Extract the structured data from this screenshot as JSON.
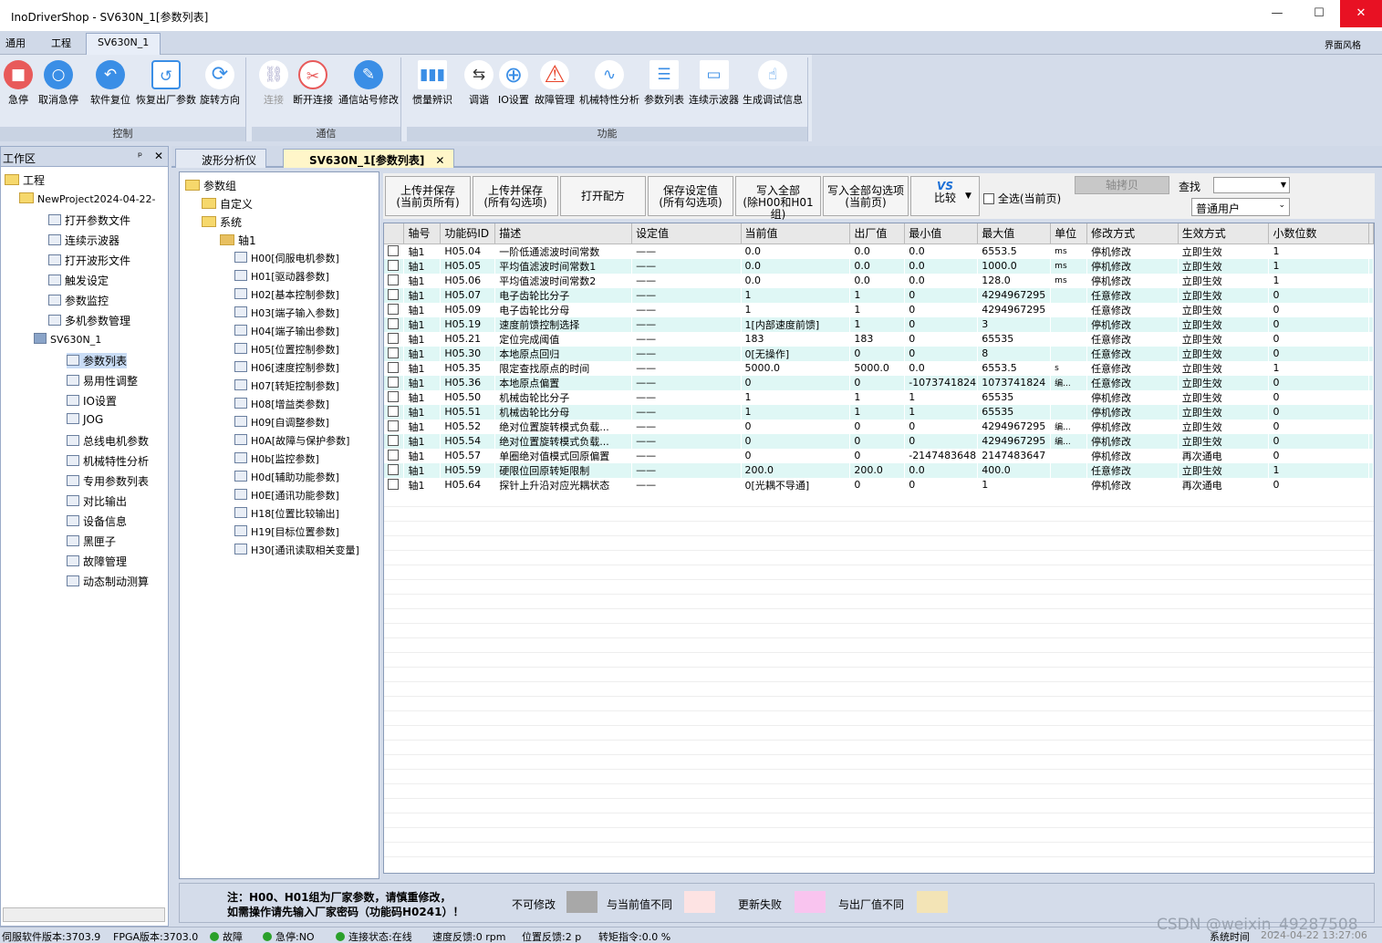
{
  "window": {
    "title": "InoDriverShop - SV630N_1[参数列表]",
    "min": "—",
    "max": "☐",
    "close": "✕"
  },
  "menu": {
    "tabs": [
      "通用",
      "工程",
      "SV630N_1"
    ],
    "style": "界面风格"
  },
  "ribbon": {
    "control": {
      "caption": "控制",
      "buttons": [
        "急停",
        "取消急停",
        "软件复位",
        "恢复出厂参数",
        "旋转方向"
      ]
    },
    "comm": {
      "caption": "通信",
      "buttons": [
        "连接",
        "断开连接",
        "通信站号修改"
      ]
    },
    "func": {
      "caption": "功能",
      "buttons": [
        "惯量辨识",
        "调谐",
        "IO设置",
        "故障管理",
        "机械特性分析",
        "参数列表",
        "连续示波器",
        "生成调试信息"
      ]
    }
  },
  "workspace": {
    "title": "工作区",
    "pin": "ᵖ",
    "close": "✕",
    "root": "工程",
    "project": "NewProject2024-04-22-",
    "items": [
      "打开参数文件",
      "连续示波器",
      "打开波形文件",
      "触发设定",
      "参数监控",
      "多机参数管理"
    ],
    "device": "SV630N_1",
    "device_items": [
      "参数列表",
      "易用性调整",
      "IO设置",
      "JOG",
      "总线电机参数",
      "机械特性分析",
      "专用参数列表",
      "对比输出",
      "设备信息",
      "黑匣子",
      "故障管理",
      "动态制动测算"
    ]
  },
  "tabs": {
    "tab1": "波形分析仪",
    "tab2": "SV630N_1[参数列表]",
    "close": "✕"
  },
  "groups": {
    "root": "参数组",
    "custom": "自定义",
    "system": "系统",
    "axis": "轴1",
    "items": [
      "H00[伺服电机参数]",
      "H01[驱动器参数]",
      "H02[基本控制参数]",
      "H03[端子输入参数]",
      "H04[端子输出参数]",
      "H05[位置控制参数]",
      "H06[速度控制参数]",
      "H07[转矩控制参数]",
      "H08[增益类参数]",
      "H09[自调整参数]",
      "H0A[故障与保护参数]",
      "H0b[监控参数]",
      "H0d[辅助功能参数]",
      "H0E[通讯功能参数]",
      "H18[位置比较输出]",
      "H19[目标位置参数]",
      "H30[通讯读取相关变量]"
    ]
  },
  "toolbar": {
    "b1a": "上传并保存",
    "b1b": "(当前页所有)",
    "b2a": "上传并保存",
    "b2b": "(所有勾选项)",
    "b3": "打开配方",
    "b4a": "保存设定值",
    "b4b": "(所有勾选项)",
    "b5a": "写入全部",
    "b5b": "(除H00和H01组)",
    "b6a": "写入全部勾选项",
    "b6b": "(当前页)",
    "b7a": "VS",
    "b7b": "比较",
    "selectall": "全选(当前页)",
    "axiscopy": "轴拷贝",
    "search": "查找",
    "user": "普通用户"
  },
  "table": {
    "headers": [
      "",
      "轴号",
      "功能码ID",
      "描述",
      "设定值",
      "当前值",
      "出厂值",
      "最小值",
      "最大值",
      "单位",
      "修改方式",
      "生效方式",
      "小数位数"
    ],
    "rows": [
      [
        "轴1",
        "H05.04",
        "一阶低通滤波时间常数",
        "——",
        "0.0",
        "0.0",
        "0.0",
        "6553.5",
        "ms",
        "停机修改",
        "立即生效",
        "1"
      ],
      [
        "轴1",
        "H05.05",
        "平均值滤波时间常数1",
        "——",
        "0.0",
        "0.0",
        "0.0",
        "1000.0",
        "ms",
        "停机修改",
        "立即生效",
        "1"
      ],
      [
        "轴1",
        "H05.06",
        "平均值滤波时间常数2",
        "——",
        "0.0",
        "0.0",
        "0.0",
        "128.0",
        "ms",
        "停机修改",
        "立即生效",
        "1"
      ],
      [
        "轴1",
        "H05.07",
        "电子齿轮比分子",
        "——",
        "1",
        "1",
        "0",
        "4294967295",
        "",
        "任意修改",
        "立即生效",
        "0"
      ],
      [
        "轴1",
        "H05.09",
        "电子齿轮比分母",
        "——",
        "1",
        "1",
        "0",
        "4294967295",
        "",
        "任意修改",
        "立即生效",
        "0"
      ],
      [
        "轴1",
        "H05.19",
        "速度前馈控制选择",
        "——",
        "1[内部速度前馈]",
        "1",
        "0",
        "3",
        "",
        "停机修改",
        "立即生效",
        "0"
      ],
      [
        "轴1",
        "H05.21",
        "定位完成阈值",
        "——",
        "183",
        "183",
        "0",
        "65535",
        "",
        "任意修改",
        "立即生效",
        "0"
      ],
      [
        "轴1",
        "H05.30",
        "本地原点回归",
        "——",
        "0[无操作]",
        "0",
        "0",
        "8",
        "",
        "任意修改",
        "立即生效",
        "0"
      ],
      [
        "轴1",
        "H05.35",
        "限定查找原点的时间",
        "——",
        "5000.0",
        "5000.0",
        "0.0",
        "6553.5",
        "s",
        "任意修改",
        "立即生效",
        "1"
      ],
      [
        "轴1",
        "H05.36",
        "本地原点偏置",
        "——",
        "0",
        "0",
        "-1073741824",
        "1073741824",
        "编...",
        "任意修改",
        "立即生效",
        "0"
      ],
      [
        "轴1",
        "H05.50",
        "机械齿轮比分子",
        "——",
        "1",
        "1",
        "1",
        "65535",
        "",
        "停机修改",
        "立即生效",
        "0"
      ],
      [
        "轴1",
        "H05.51",
        "机械齿轮比分母",
        "——",
        "1",
        "1",
        "1",
        "65535",
        "",
        "停机修改",
        "立即生效",
        "0"
      ],
      [
        "轴1",
        "H05.52",
        "绝对位置旋转模式负载...",
        "——",
        "0",
        "0",
        "0",
        "4294967295",
        "编...",
        "停机修改",
        "立即生效",
        "0"
      ],
      [
        "轴1",
        "H05.54",
        "绝对位置旋转模式负载...",
        "——",
        "0",
        "0",
        "0",
        "4294967295",
        "编...",
        "停机修改",
        "立即生效",
        "0"
      ],
      [
        "轴1",
        "H05.57",
        "单圈绝对值模式回原偏置",
        "——",
        "0",
        "0",
        "-2147483648",
        "2147483647",
        "",
        "停机修改",
        "再次通电",
        "0"
      ],
      [
        "轴1",
        "H05.59",
        "硬限位回原转矩限制",
        "——",
        "200.0",
        "200.0",
        "0.0",
        "400.0",
        "",
        "任意修改",
        "立即生效",
        "1"
      ],
      [
        "轴1",
        "H05.64",
        "探针上升沿对应光耦状态",
        "——",
        "0[光耦不导通]",
        "0",
        "0",
        "1",
        "",
        "停机修改",
        "再次通电",
        "0"
      ]
    ]
  },
  "footer": {
    "note1": "注：H00、H01组为厂家参数，请慎重修改，",
    "note2": "如需操作请先输入厂家密码（功能码H0241）！",
    "legend": [
      "不可修改",
      "与当前值不同",
      "更新失败",
      "与出厂值不同"
    ],
    "colors": [
      "#a8a8a8",
      "#fde3e3",
      "#f9c4ef",
      "#f3e4b6"
    ]
  },
  "status": {
    "sw": "伺服软件版本:3703.9",
    "fpga": "FPGA版本:3703.0",
    "fault": "故障",
    "estop": "急停:NO",
    "conn": "连接状态:在线",
    "speed": "速度反馈:0 rpm",
    "pos": "位置反馈:2 p",
    "torque": "转矩指令:0.0 %",
    "systime": "系统时间",
    "time": "2024-04-22 13:27:06"
  },
  "watermark": "CSDN @weixin_49287508"
}
